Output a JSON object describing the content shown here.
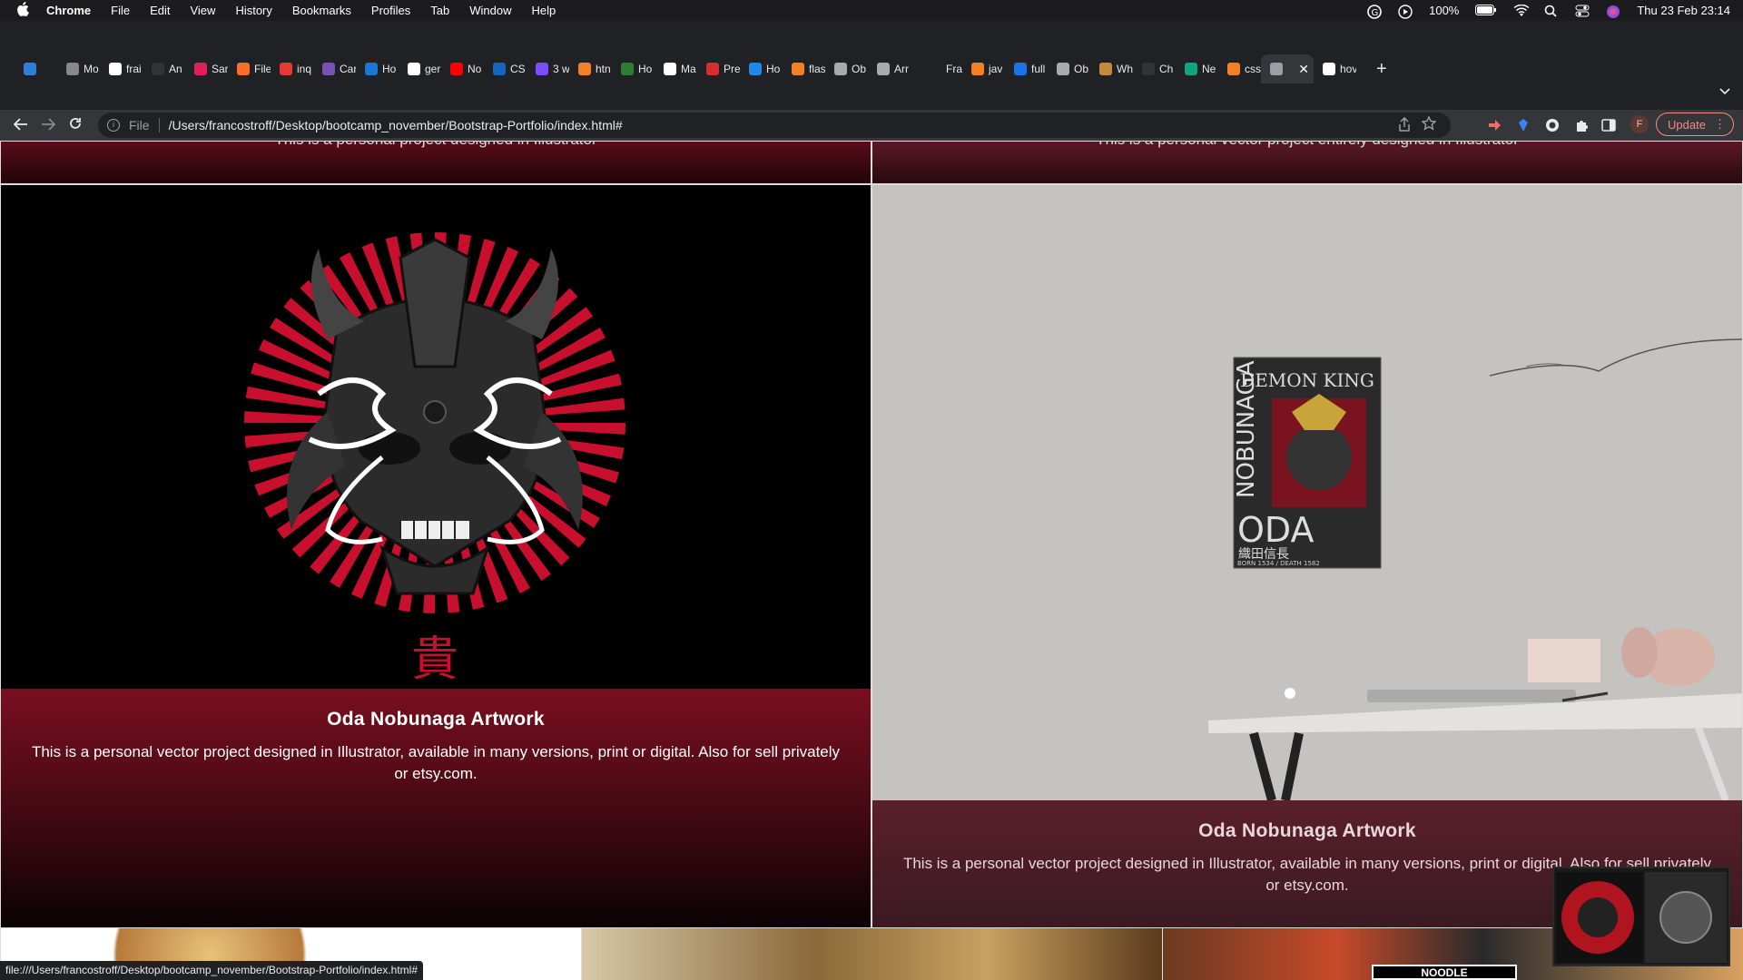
{
  "menubar": {
    "app": "Chrome",
    "items": [
      "File",
      "Edit",
      "View",
      "History",
      "Bookmarks",
      "Profiles",
      "Tab",
      "Window",
      "Help"
    ],
    "battery": "100%",
    "datetime": "Thu 23 Feb  23:14"
  },
  "tabs": [
    {
      "label": "",
      "color": "#2f7fd9"
    },
    {
      "label": "Mo",
      "color": "#888888"
    },
    {
      "label": "frai",
      "color": "#ffffff"
    },
    {
      "label": "An",
      "color": "#333333"
    },
    {
      "label": "Sar",
      "color": "#e01e5a"
    },
    {
      "label": "File",
      "color": "#fc6d26"
    },
    {
      "label": "inq",
      "color": "#e53935"
    },
    {
      "label": "Car",
      "color": "#7952b3"
    },
    {
      "label": "Ho",
      "color": "#1976d2"
    },
    {
      "label": "ger",
      "color": "#ffffff"
    },
    {
      "label": "No",
      "color": "#ff0000"
    },
    {
      "label": "CS",
      "color": "#1565c0"
    },
    {
      "label": "3 w",
      "color": "#7c4dff"
    },
    {
      "label": "htn",
      "color": "#f48024"
    },
    {
      "label": "Ho",
      "color": "#2e7d32"
    },
    {
      "label": "Ma",
      "color": "#ffffff"
    },
    {
      "label": "Pre",
      "color": "#d32f2f"
    },
    {
      "label": "Ho",
      "color": "#1e88e5"
    },
    {
      "label": "flas",
      "color": "#f48024"
    },
    {
      "label": "Ob",
      "color": "#aaaaaa"
    },
    {
      "label": "Arr",
      "color": "#aaaaaa"
    },
    {
      "label": "Fra",
      "color": "#202124"
    },
    {
      "label": "jav",
      "color": "#f48024"
    },
    {
      "label": "full",
      "color": "#1a73e8"
    },
    {
      "label": "Ob",
      "color": "#aaaaaa"
    },
    {
      "label": "Wh",
      "color": "#c48a3a"
    },
    {
      "label": "Ch",
      "color": "#333333"
    },
    {
      "label": "Ne",
      "color": "#10a37f"
    },
    {
      "label": "css",
      "color": "#f48024"
    },
    {
      "label": "",
      "color": "#9aa0a6",
      "active": true
    },
    {
      "label": "hov",
      "color": "#ffffff"
    }
  ],
  "toolbar": {
    "scheme": "File",
    "url": "/Users/francostroff/Desktop/bootcamp_november/Bootstrap-Portfolio/index.html#",
    "profile_initial": "F",
    "update_label": "Update"
  },
  "page": {
    "top_left_snippet": "This is a personal project designed in Illustrator",
    "top_right_snippet": "This is a personal vector project entirely designed in Illustrator",
    "card_a": {
      "title": "Oda Nobunaga Artwork",
      "desc": "This is a personal vector project designed in Illustrator, available in many versions, print or digital. Also for sell privately or etsy.com.",
      "kanji": "貴"
    },
    "card_b": {
      "title": "Oda Nobunaga Artwork",
      "desc": "This is a personal vector project designed in Illustrator, available in many versions, print or digital. Also for sell privately or etsy.com.",
      "poster_title": "DEMON KING",
      "poster_side": "NOBUNAGA",
      "poster_name": "ODA",
      "poster_kanji": "織田信長",
      "poster_dates": "BORN 1534 / DEATH 1582"
    },
    "bottom_banner": "NOODLE"
  },
  "statusbar": {
    "url": "file:///Users/francostroff/Desktop/bootcamp_november/Bootstrap-Portfolio/index.html#"
  },
  "colors": {
    "accent_red": "#c8102e",
    "card_gradient_top": "#7a0f1f"
  }
}
